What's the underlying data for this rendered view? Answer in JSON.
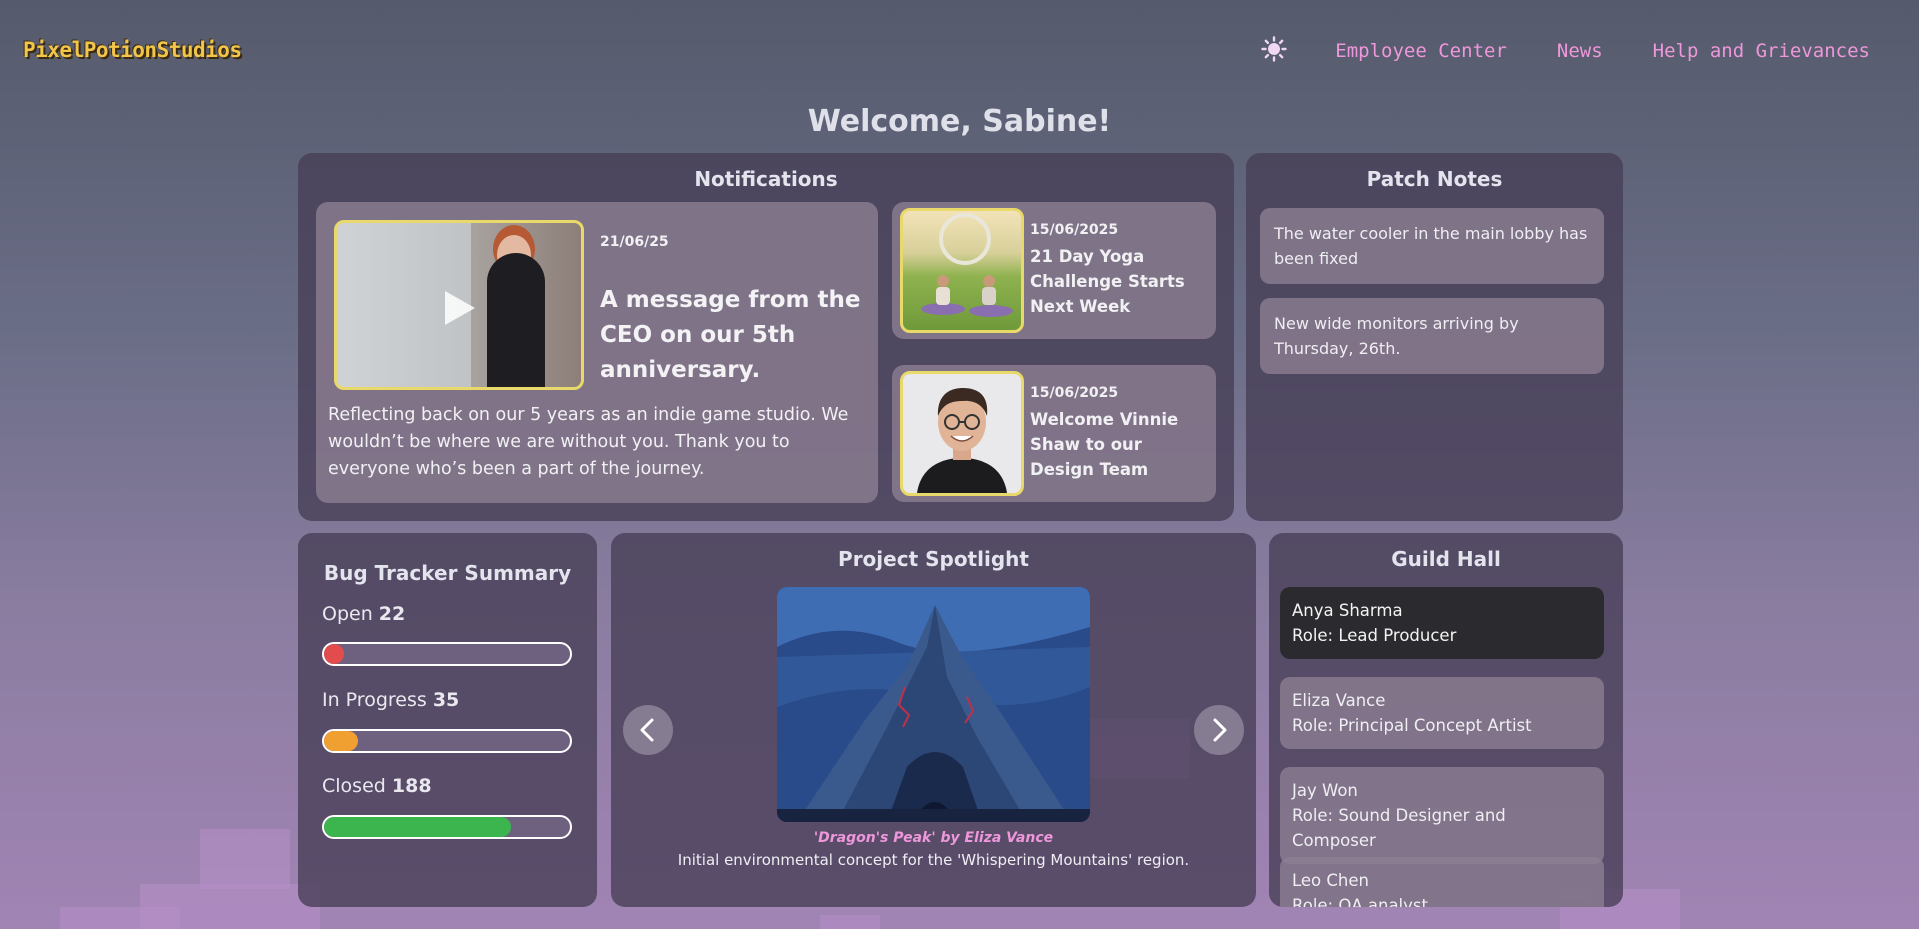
{
  "header": {
    "logo": "PixelPotionStudios",
    "theme_icon": "sun-icon",
    "nav": [
      "Employee Center",
      "News",
      "Help and Grievances"
    ]
  },
  "welcome": "Welcome, Sabine!",
  "notifications": {
    "title": "Notifications",
    "featured": {
      "date": "21/06/25",
      "title": "A message from the CEO on our 5th anniversary.",
      "body": "Reflecting back on our 5 years as an indie game studio. We wouldn’t be where we are without you. Thank you to everyone who’s been a part of the journey.",
      "media": "video-play-icon"
    },
    "items": [
      {
        "date": "15/06/2025",
        "title": "21 Day Yoga Challenge Starts Next Week"
      },
      {
        "date": "15/06/2025",
        "title": "Welcome Vinnie Shaw to our Design Team"
      }
    ]
  },
  "patch_notes": {
    "title": "Patch Notes",
    "items": [
      "The water cooler in the main lobby has been fixed",
      "New wide monitors arriving by Thursday, 26th."
    ]
  },
  "bug_tracker": {
    "title": "Bug Tracker Summary",
    "items": [
      {
        "label": "Open",
        "count": "22",
        "fraction": 0.08,
        "color": "#e24c4c"
      },
      {
        "label": "In Progress",
        "count": "35",
        "fraction": 0.14,
        "color": "#f0a030"
      },
      {
        "label": "Closed",
        "count": "188",
        "fraction": 0.76,
        "color": "#3db54e"
      }
    ]
  },
  "spotlight": {
    "title": "Project Spotlight",
    "caption": "'Dragon's Peak' by Eliza Vance",
    "description": "Initial environmental concept for the 'Whispering Mountains' region.",
    "prev_icon": "chevron-left-icon",
    "next_icon": "chevron-right-icon"
  },
  "guild_hall": {
    "title": "Guild Hall",
    "members": [
      {
        "name": "Anya Sharma",
        "role": "Role: Lead Producer"
      },
      {
        "name": "Eliza Vance",
        "role": "Role: Principal Concept Artist"
      },
      {
        "name": "Jay Won",
        "role": "Role: Sound Designer and Composer"
      },
      {
        "name": "Leo Chen",
        "role": "Role: QA analyst"
      }
    ]
  }
}
